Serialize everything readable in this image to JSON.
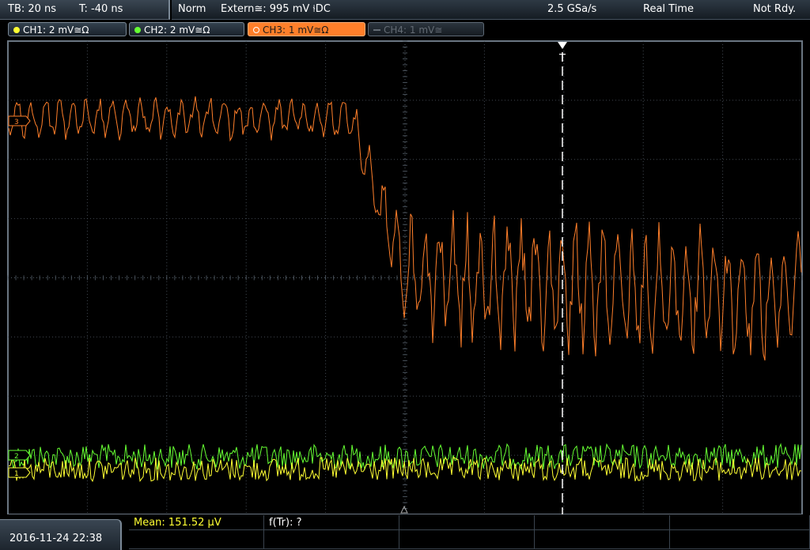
{
  "topbar": {
    "timebase": "TB: 20 ns",
    "trigger_offset": "T: -40 ns",
    "trigger_mode": "Norm",
    "trigger_source": "Extern≅: 995 mV ⫮DC",
    "sample_rate": "2.5 GSa/s",
    "acq_mode": "Real Time",
    "status": "Not Rdy."
  },
  "channels": [
    {
      "label": "CH1: 2 mV≅Ω",
      "color": "#ffff33",
      "active": true
    },
    {
      "label": "CH2: 2 mV≅Ω",
      "color": "#66ff33",
      "active": true
    },
    {
      "label": "CH3: 1 mV≅Ω",
      "color": "#ff7f2a",
      "active": true,
      "selected": true
    },
    {
      "label": "CH4: 1 mV≅",
      "color": "#636b74",
      "active": false
    }
  ],
  "markers": {
    "ch3_marker": "3",
    "ch2_marker": "2",
    "ch1_marker": "1",
    "trigger_marker": "T"
  },
  "bottom": {
    "datetime": "2016-11-24 22:38",
    "mean_label": "Mean: 151.52 µV",
    "rise_label": "f(Tr): ?"
  },
  "colors": {
    "grid": "#505a64",
    "ch1": "#ffff33",
    "ch2": "#66ff33",
    "ch3": "#ff7f2a",
    "cursor": "#ffffff"
  }
}
